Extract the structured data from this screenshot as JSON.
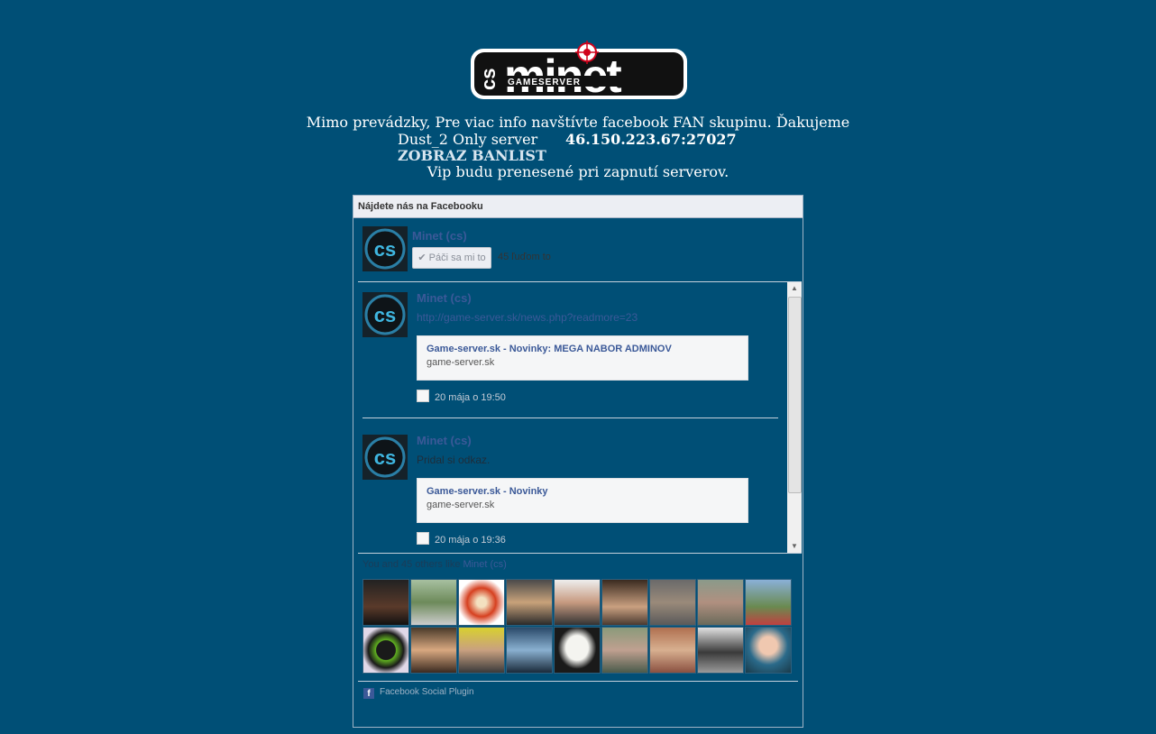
{
  "logo": {
    "brand": "minet",
    "prefix": "cs",
    "subtitle": "GAMESERVER"
  },
  "notice": {
    "line1": "Mimo prevádzky, Pre viac info navštívte facebook FAN skupinu. Ďakujeme",
    "server_name": "Dust_2 Only server",
    "server_ip": "46.150.223.67:27027",
    "banlist_label": "ZOBRAZ BANLIST",
    "vip_text": "Vip budu prenesené pri zapnutí serverov."
  },
  "fb_box": {
    "header": "Nájdete nás na Facebooku",
    "page_name": "Minet (cs)",
    "like_label": "Páči sa mi to",
    "like_count": "45 ľuďom to",
    "posts": [
      {
        "author": "Minet (cs)",
        "link": "http://game-server.sk/news.php?readmore=23",
        "attachment_title": "Game-server.sk - Novinky: MEGA NABOR ADMINOV",
        "attachment_domain": "game-server.sk",
        "time": "20 mája o 19:50"
      },
      {
        "author": "Minet (cs)",
        "text": "Pridal si odkaz.",
        "attachment_title": "Game-server.sk - Novinky",
        "attachment_domain": "game-server.sk",
        "time": "20 mája o 19:36"
      }
    ],
    "fans_prefix": "You and 45 others like",
    "fans_page": "Minet (cs)",
    "footer": "Facebook Social Plugin"
  },
  "colors": {
    "background": "#004f76",
    "link": "#3b5998",
    "panel_header": "#eceef3"
  },
  "icons": [
    "target-icon",
    "check-icon",
    "share-icon",
    "facebook-icon",
    "scroll-up-icon",
    "scroll-down-icon"
  ]
}
